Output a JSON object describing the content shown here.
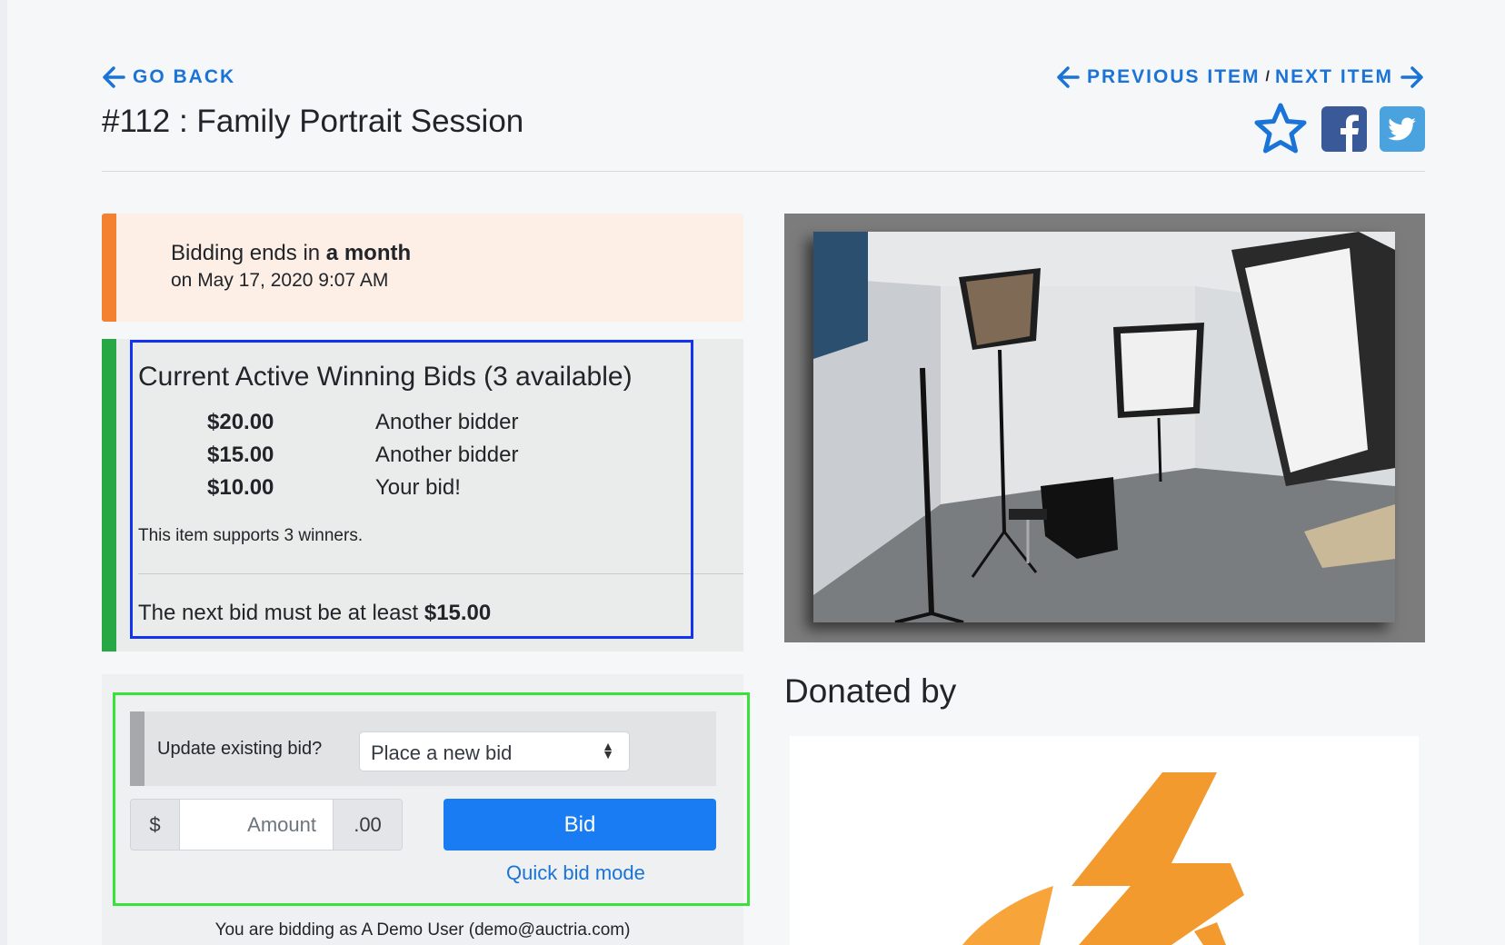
{
  "header": {
    "go_back_label": "GO BACK",
    "previous_label": "PREVIOUS ITEM",
    "separator": "/",
    "next_label": "NEXT ITEM",
    "title": "#112 : Family Portrait Session"
  },
  "social": {
    "icons": [
      "star-icon",
      "facebook-icon",
      "twitter-icon"
    ]
  },
  "ending": {
    "prefix": "Bidding ends in ",
    "relative": "a month",
    "date_line": "on May 17, 2020 9:07 AM"
  },
  "bids": {
    "title": "Current Active Winning Bids (3 available)",
    "rows": [
      {
        "amount": "$20.00",
        "bidder": "Another bidder"
      },
      {
        "amount": "$15.00",
        "bidder": "Another bidder"
      },
      {
        "amount": "$10.00",
        "bidder": "Your bid!"
      }
    ],
    "note": "This item supports 3 winners.",
    "next_prefix": "The next bid must be at least ",
    "next_amount": "$15.00"
  },
  "bid_form": {
    "update_label": "Update existing bid?",
    "select_value": "Place a new bid",
    "currency_prefix": "$",
    "amount_placeholder": "Amount",
    "cents_suffix": ".00",
    "bid_button": "Bid",
    "quick_bid_link": "Quick bid mode",
    "bidding_as": "You are bidding as A Demo User (demo@auctria.com)"
  },
  "donated": {
    "title": "Donated by"
  },
  "colors": {
    "link": "#1a73d6",
    "primary": "#1a7cf2",
    "warning_border": "#f4812f",
    "success_border": "#28a745",
    "logo_orange": "#f39a2e"
  }
}
